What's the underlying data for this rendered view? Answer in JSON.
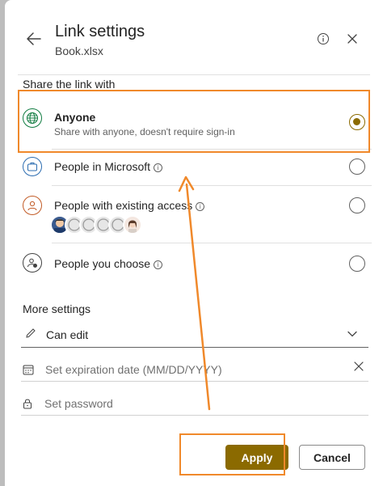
{
  "header": {
    "title": "Link settings",
    "subtitle": "Book.xlsx"
  },
  "share_section": {
    "label": "Share the link with",
    "options": [
      {
        "title": "Anyone",
        "description": "Share with anyone, doesn't require sign-in",
        "icon": "globe-icon",
        "selected": true
      },
      {
        "title": "People in Microsoft",
        "icon": "briefcase-icon",
        "selected": false
      },
      {
        "title": "People with existing access",
        "icon": "person-icon",
        "selected": false
      },
      {
        "title": "People you choose",
        "icon": "person-settings-icon",
        "selected": false
      }
    ]
  },
  "more_settings": {
    "label": "More settings",
    "permission": "Can edit",
    "expiration_placeholder": "Set expiration date (MM/DD/YYYY)",
    "password_placeholder": "Set password"
  },
  "footer": {
    "apply_label": "Apply",
    "cancel_label": "Cancel"
  },
  "colors": {
    "accent": "#8b6a00",
    "annotation": "#f0892b",
    "globe_green": "#107c41",
    "briefcase_blue": "#2b6cb0",
    "person_orange": "#c25b26"
  }
}
